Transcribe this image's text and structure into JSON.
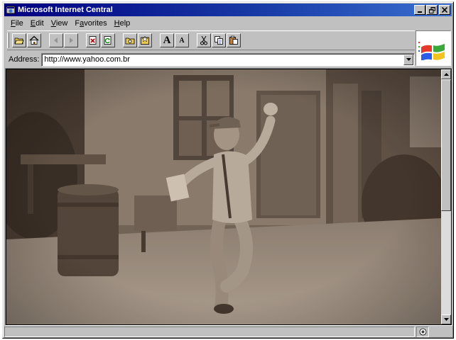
{
  "window": {
    "title": "Microsoft Internet Central",
    "controls": [
      "minimize",
      "restore",
      "close"
    ]
  },
  "menu": [
    {
      "label": "File",
      "mnemonic": "F"
    },
    {
      "label": "Edit",
      "mnemonic": "E"
    },
    {
      "label": "View",
      "mnemonic": "V"
    },
    {
      "label": "Favorites",
      "mnemonic": "a"
    },
    {
      "label": "Help",
      "mnemonic": "H"
    }
  ],
  "toolbar": {
    "buttons": [
      {
        "icon": "open-folder-icon"
      },
      {
        "icon": "home-icon"
      },
      {
        "icon": "back-arrow-icon",
        "disabled": true
      },
      {
        "icon": "forward-arrow-icon",
        "disabled": true
      },
      {
        "icon": "stop-icon"
      },
      {
        "icon": "refresh-icon"
      },
      {
        "icon": "search-folder-icon"
      },
      {
        "icon": "favorites-icon"
      },
      {
        "icon": "font-larger-icon",
        "label": "A"
      },
      {
        "icon": "font-smaller-icon",
        "label": "A"
      },
      {
        "icon": "cut-icon"
      },
      {
        "icon": "copy-icon"
      },
      {
        "icon": "paste-icon"
      }
    ]
  },
  "address": {
    "label": "Address:",
    "value": "http://www.yahoo.com.br"
  },
  "brand": {
    "icon": "windows-flag-icon"
  },
  "content": {
    "media": "sepia video frame of a child dancing in a courtyard"
  },
  "status": {
    "text": "",
    "zone_icon": "internet-zone-icon"
  },
  "colors": {
    "titlebar": "#000080",
    "chrome": "#c0c0c0",
    "video_tint": "#7d7064"
  }
}
